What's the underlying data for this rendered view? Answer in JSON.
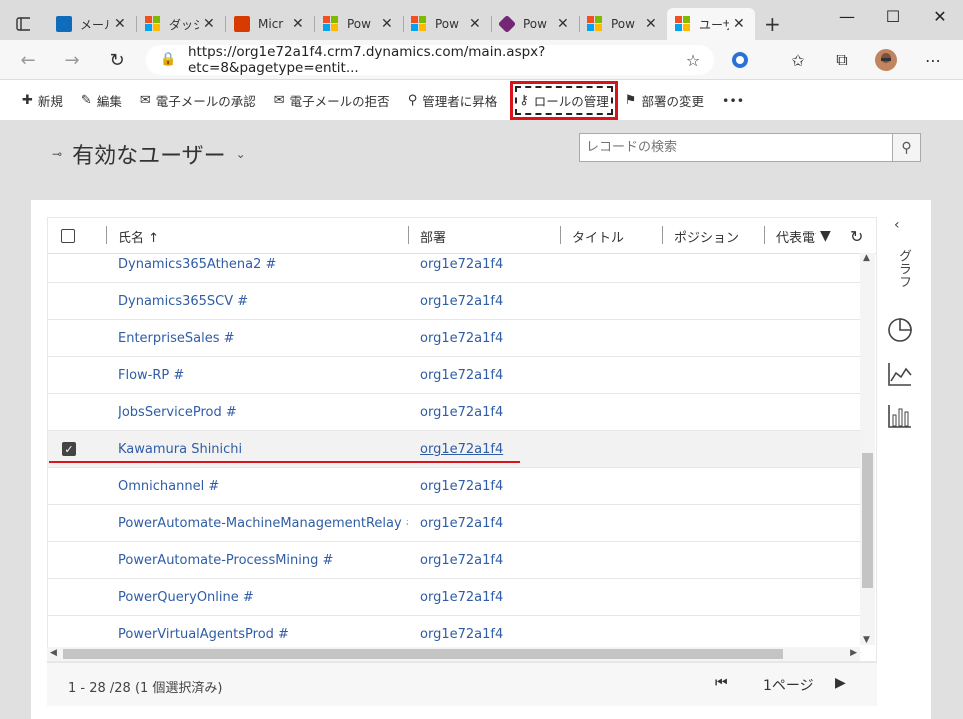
{
  "browser": {
    "tabs": [
      {
        "label": "メール",
        "favicon": "outlook-icon",
        "color": "#0f6cbd"
      },
      {
        "label": "ダッシュ",
        "favicon": "microsoft-icon"
      },
      {
        "label": "Micr",
        "favicon": "office-icon",
        "color": "#d83b01"
      },
      {
        "label": "Pow",
        "favicon": "microsoft-icon"
      },
      {
        "label": "Pow",
        "favicon": "microsoft-icon"
      },
      {
        "label": "Pow",
        "favicon": "powerapps-icon",
        "color": "#742774"
      },
      {
        "label": "Pow",
        "favicon": "microsoft-icon"
      },
      {
        "label": "ユーザ",
        "favicon": "microsoft-icon",
        "active": true
      }
    ],
    "url": "https://org1e72a1f4.crm7.dynamics.com/main.aspx?etc=8&pagetype=entit..."
  },
  "commands": {
    "new": "新規",
    "edit": "編集",
    "approve_email": "電子メールの承認",
    "reject_email": "電子メールの拒否",
    "promote_admin": "管理者に昇格",
    "manage_roles": "ロールの管理",
    "change_bu": "部署の変更",
    "more": "•••"
  },
  "view": {
    "title": "有効なユーザー",
    "search_placeholder": "レコードの検索"
  },
  "grid": {
    "columns": {
      "name": "氏名 ↑",
      "dept": "部署",
      "title": "タイトル",
      "position": "ポジション",
      "main_phone": "代表電話"
    },
    "rows": [
      {
        "name": "Dynamics365Athena2 #",
        "dept": "org1e72a1f4",
        "selected": false
      },
      {
        "name": "Dynamics365SCV #",
        "dept": "org1e72a1f4",
        "selected": false
      },
      {
        "name": "EnterpriseSales #",
        "dept": "org1e72a1f4",
        "selected": false
      },
      {
        "name": "Flow-RP #",
        "dept": "org1e72a1f4",
        "selected": false
      },
      {
        "name": "JobsServiceProd #",
        "dept": "org1e72a1f4",
        "selected": false
      },
      {
        "name": "Kawamura Shinichi",
        "dept": "org1e72a1f4",
        "selected": true
      },
      {
        "name": "Omnichannel #",
        "dept": "org1e72a1f4",
        "selected": false
      },
      {
        "name": "PowerAutomate-MachineManagementRelay #",
        "dept": "org1e72a1f4",
        "selected": false
      },
      {
        "name": "PowerAutomate-ProcessMining #",
        "dept": "org1e72a1f4",
        "selected": false
      },
      {
        "name": "PowerQueryOnline #",
        "dept": "org1e72a1f4",
        "selected": false
      },
      {
        "name": "PowerVirtualAgentsProd #",
        "dept": "org1e72a1f4",
        "selected": false
      }
    ],
    "footer_count": "1 - 28 /28 (1 個選択済み)",
    "page_label": "1ページ"
  },
  "side_panel": {
    "label": "グラフ"
  },
  "colors": {
    "link": "#2f5da6",
    "highlight_red": "#d9141c"
  }
}
